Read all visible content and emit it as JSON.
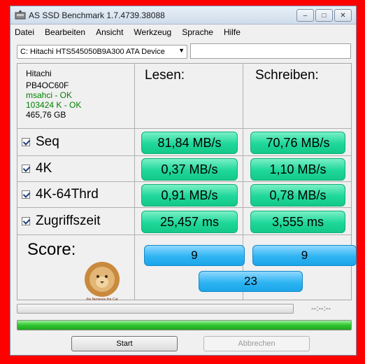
{
  "window": {
    "title": "AS SSD Benchmark 1.7.4739.38088"
  },
  "menu": [
    "Datei",
    "Bearbeiten",
    "Ansicht",
    "Werkzeug",
    "Sprache",
    "Hilfe"
  ],
  "drive": {
    "selected": "C: Hitachi HTS545050B9A300 ATA Device",
    "extra_value": ""
  },
  "drive_info": {
    "vendor": "Hitachi",
    "firmware": "PB4OC60F",
    "driver": "msahci - OK",
    "alignment": "103424 K - OK",
    "size": "465,76 GB"
  },
  "columns": {
    "read": "Lesen:",
    "write": "Schreiben:"
  },
  "tests": [
    {
      "label": "Seq",
      "checked": true,
      "read": "81,84 MB/s",
      "write": "70,76 MB/s"
    },
    {
      "label": "4K",
      "checked": true,
      "read": "0,37 MB/s",
      "write": "1,10 MB/s"
    },
    {
      "label": "4K-64Thrd",
      "checked": true,
      "read": "0,91 MB/s",
      "write": "0,78 MB/s"
    },
    {
      "label": "Zugriffszeit",
      "checked": true,
      "read": "25,457 ms",
      "write": "3,555 ms"
    }
  ],
  "score": {
    "label": "Score:",
    "read": "9",
    "write": "9",
    "total": "23",
    "logo_caption": "the Nemesis the Cat"
  },
  "progress": {
    "time": "--:--:--",
    "test_progress": 0,
    "total_progress": 1.0
  },
  "buttons": {
    "start": "Start",
    "abort": "Abbrechen"
  },
  "colors": {
    "result_green": "#1ed79a",
    "score_blue": "#2fb4f2",
    "progress_green": "#2fc52f",
    "frame_red": "#ff0000"
  }
}
